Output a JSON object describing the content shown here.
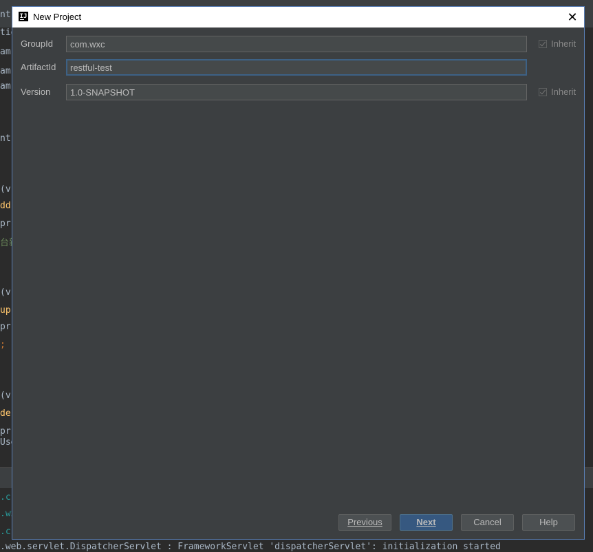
{
  "dialog": {
    "title": "New Project",
    "close_glyph": "✕"
  },
  "form": {
    "group_id": {
      "label": "GroupId",
      "value": "com.wxc",
      "inherit_label": "Inherit"
    },
    "artifact_id": {
      "label": "ArtifactId",
      "value": "restful-test"
    },
    "version": {
      "label": "Version",
      "value": "1.0-SNAPSHOT",
      "inherit_label": "Inherit"
    }
  },
  "buttons": {
    "previous": "Previous",
    "next": "Next",
    "cancel": "Cancel",
    "help": "Help"
  },
  "background": {
    "lines": [
      {
        "text": "ntr",
        "color": "#a9b7c6"
      },
      {
        "text": "tio",
        "color": "#a9b7c6"
      },
      {
        "text": "am",
        "color": "#a9b7c6"
      },
      {
        "text": "am",
        "color": "#a9b7c6"
      },
      {
        "text": "am",
        "color": "#a9b7c6"
      },
      {
        "text": "ntr",
        "color": "#a9b7c6"
      },
      {
        "text": "(v",
        "color": "#a9b7c6"
      },
      {
        "text": "dd",
        "color": "#ffc66d"
      },
      {
        "text": "pr",
        "color": "#a9b7c6"
      },
      {
        "text": "台新",
        "color": "#6a8759"
      },
      {
        "text": "(v",
        "color": "#a9b7c6"
      },
      {
        "text": "up",
        "color": "#ffc66d"
      },
      {
        "text": "pr",
        "color": "#a9b7c6"
      },
      {
        "text": ";",
        "color": "#cc7832"
      },
      {
        "text": "(v",
        "color": "#a9b7c6"
      },
      {
        "text": "de",
        "color": "#ffc66d"
      },
      {
        "text": "pr",
        "color": "#a9b7c6"
      },
      {
        "text": "Use",
        "color": "#a9b7c6"
      }
    ],
    "console": [
      {
        "text": ".c",
        "color": "#299999"
      },
      {
        "text": ".wx",
        "color": "#299999"
      },
      {
        "text": ".c",
        "color": "#299999"
      },
      {
        "text": ".web.servlet.DispatcherServlet        : FrameworkServlet 'dispatcherServlet': initialization started",
        "color": "#a9b7c6"
      }
    ]
  }
}
